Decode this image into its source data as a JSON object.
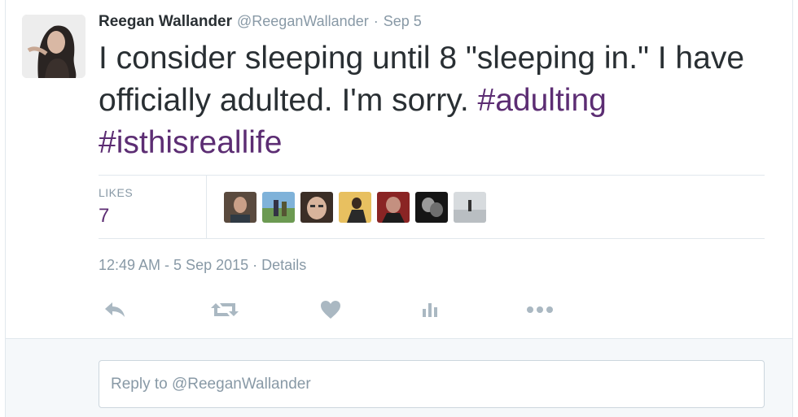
{
  "tweet": {
    "fullname": "Reegan Wallander",
    "username": "@ReeganWallander",
    "separator": "·",
    "date": "Sep 5",
    "text_plain": "I consider sleeping until 8 \"sleeping in.\" I have officially adulted. I'm sorry. ",
    "hashtags": [
      "#adulting",
      "#isthisreallife"
    ]
  },
  "stats": {
    "likes_label": "LIKES",
    "likes_count": "7"
  },
  "footer": {
    "timestamp": "12:49 AM - 5 Sep 2015",
    "separator": "·",
    "details": "Details"
  },
  "actions": [
    "reply-icon",
    "retweet-icon",
    "like-icon",
    "analytics-icon",
    "more-icon"
  ],
  "reply": {
    "placeholder": "Reply to @ReeganWallander"
  },
  "colors": {
    "hashtag": "#5c2d73",
    "muted": "#8899a6",
    "text": "#292f33",
    "action_icon": "#aab8c2"
  }
}
